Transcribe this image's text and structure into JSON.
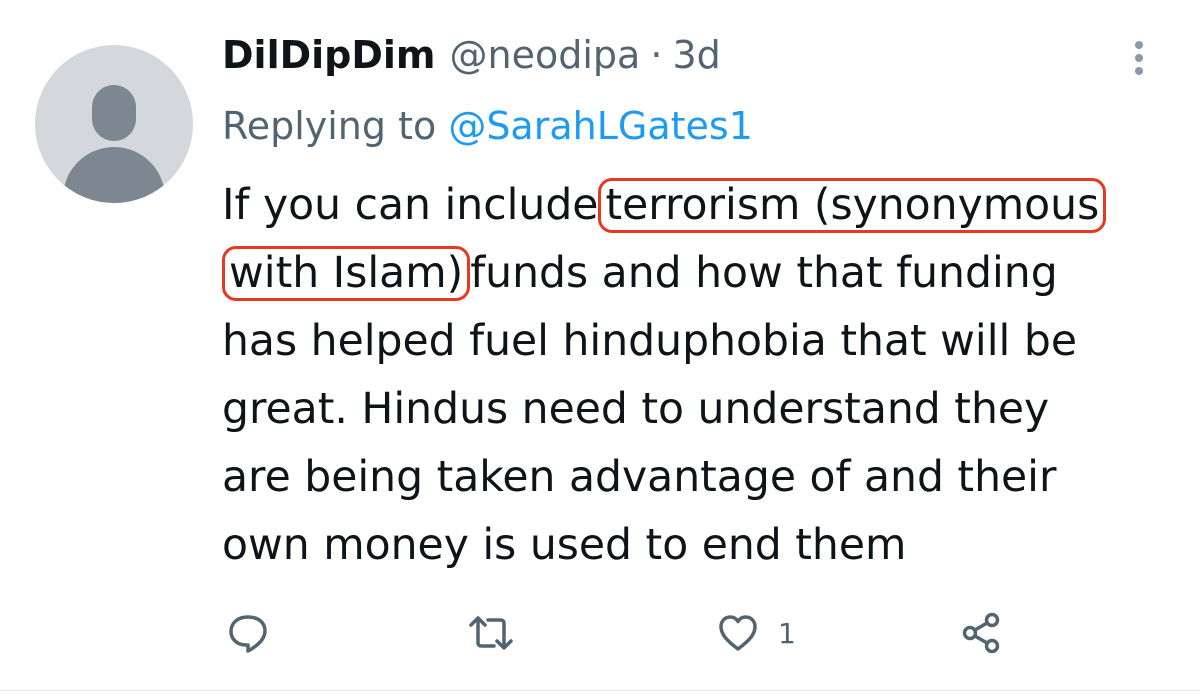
{
  "tweet": {
    "display_name": "DilDipDim",
    "handle": "@neodipa",
    "separator": "·",
    "time": "3d",
    "replying_prefix": "Replying to ",
    "replying_to": "@SarahLGates1",
    "body": {
      "line1_a": "If you can include",
      "line1_hl": "terrorism (synonymous",
      "line2_hl": "with Islam)",
      "line2_b": "funds and how that funding",
      "line3": "has helped fuel hinduphobia that will be",
      "line4": "great. Hindus need to understand they",
      "line5": "are being taken advantage of and their",
      "line6": "own money is used to end them"
    },
    "actions": {
      "like_count": "1"
    }
  },
  "colors": {
    "text": "#0f1419",
    "secondary": "#536471",
    "link": "#1d9bf0",
    "highlight": "#e53a1f",
    "avatar_bg": "#d3d8dd",
    "avatar_fg": "#7d8791"
  },
  "icons": [
    "more-vertical-icon",
    "reply-icon",
    "retweet-icon",
    "heart-icon",
    "share-icon",
    "default-avatar-icon"
  ]
}
